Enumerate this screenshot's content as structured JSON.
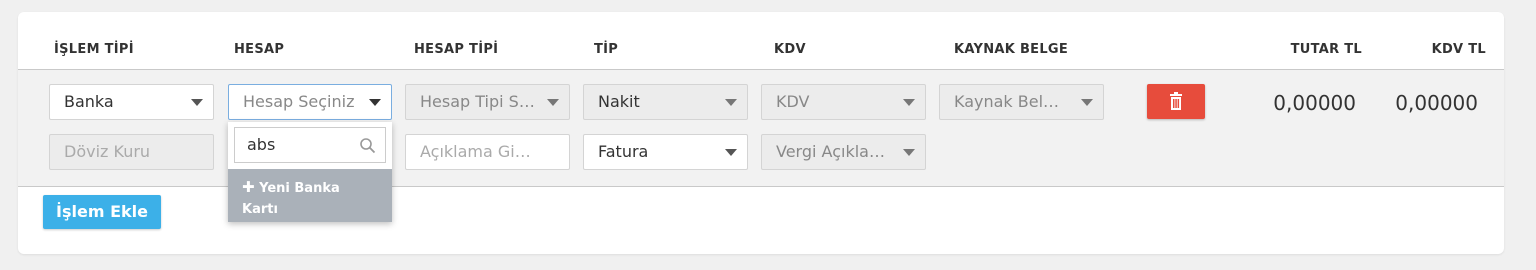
{
  "headers": {
    "islem_tipi": "İŞLEM TİPİ",
    "hesap": "HESAP",
    "hesap_tipi": "HESAP TİPİ",
    "tip": "TİP",
    "kdv": "KDV",
    "kaynak_belge": "KAYNAK BELGE",
    "tutar": "TUTAR TL",
    "kdv_tl": "KDV TL"
  },
  "row": {
    "islem_tipi": "Banka",
    "hesap_placeholder": "Hesap Seçiniz",
    "hesap_tipi_placeholder": "Hesap Tipi Seç...",
    "tip": "Nakit",
    "kdv_placeholder": "KDV",
    "kaynak_belge_placeholder": "Kaynak Belge ...",
    "doviz_kuru_placeholder": "Döviz Kuru",
    "aciklama_placeholder": "Açıklama Giriniz",
    "belge_tipi": "Fatura",
    "vergi_aciklamasi_placeholder": "Vergi Açıklaması",
    "tutar": "0,00000",
    "kdv_tutar": "0,00000"
  },
  "dropdown": {
    "search_value": "abs",
    "new_item_label": "Yeni Banka Kartı"
  },
  "actions": {
    "add_label": "İşlem Ekle"
  },
  "colors": {
    "delete": "#e74c3c",
    "add": "#3cb0e8",
    "focus_border": "#7aaee0",
    "dropdown_item_bg": "#aab1b9"
  }
}
